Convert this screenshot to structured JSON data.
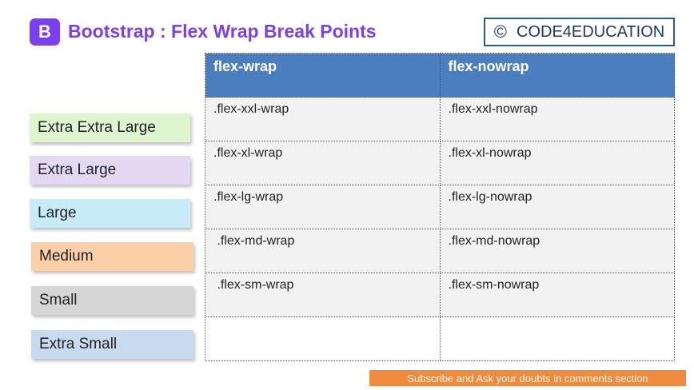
{
  "header": {
    "logo_letter": "B",
    "title": "Bootstrap : Flex Wrap Break Points",
    "brand_symbol": "©",
    "brand_name": "CODE4EDUCATION"
  },
  "breakpoints": [
    {
      "label": "Extra Extra Large",
      "color": "#dff5cf"
    },
    {
      "label": "Extra Large",
      "color": "#e3d9f3"
    },
    {
      "label": "Large",
      "color": "#c7ecf8"
    },
    {
      "label": "Medium",
      "color": "#fbd0a8"
    },
    {
      "label": "Small",
      "color": "#d6d6d6"
    },
    {
      "label": "Extra Small",
      "color": "#c9d9ee"
    }
  ],
  "table": {
    "headers": [
      "flex-wrap",
      "flex-nowrap"
    ],
    "rows": [
      [
        ".flex-xxl-wrap",
        ".flex-xxl-nowrap"
      ],
      [
        ".flex-xl-wrap",
        ".flex-xl-nowrap"
      ],
      [
        ".flex-lg-wrap",
        ".flex-lg-nowrap"
      ],
      [
        " .flex-md-wrap",
        ".flex-md-nowrap"
      ],
      [
        " .flex-sm-wrap",
        ".flex-sm-nowrap"
      ],
      [
        "",
        ""
      ]
    ]
  },
  "footer": {
    "subscribe_text": "Subscribe and Ask your doubts in comments section"
  }
}
